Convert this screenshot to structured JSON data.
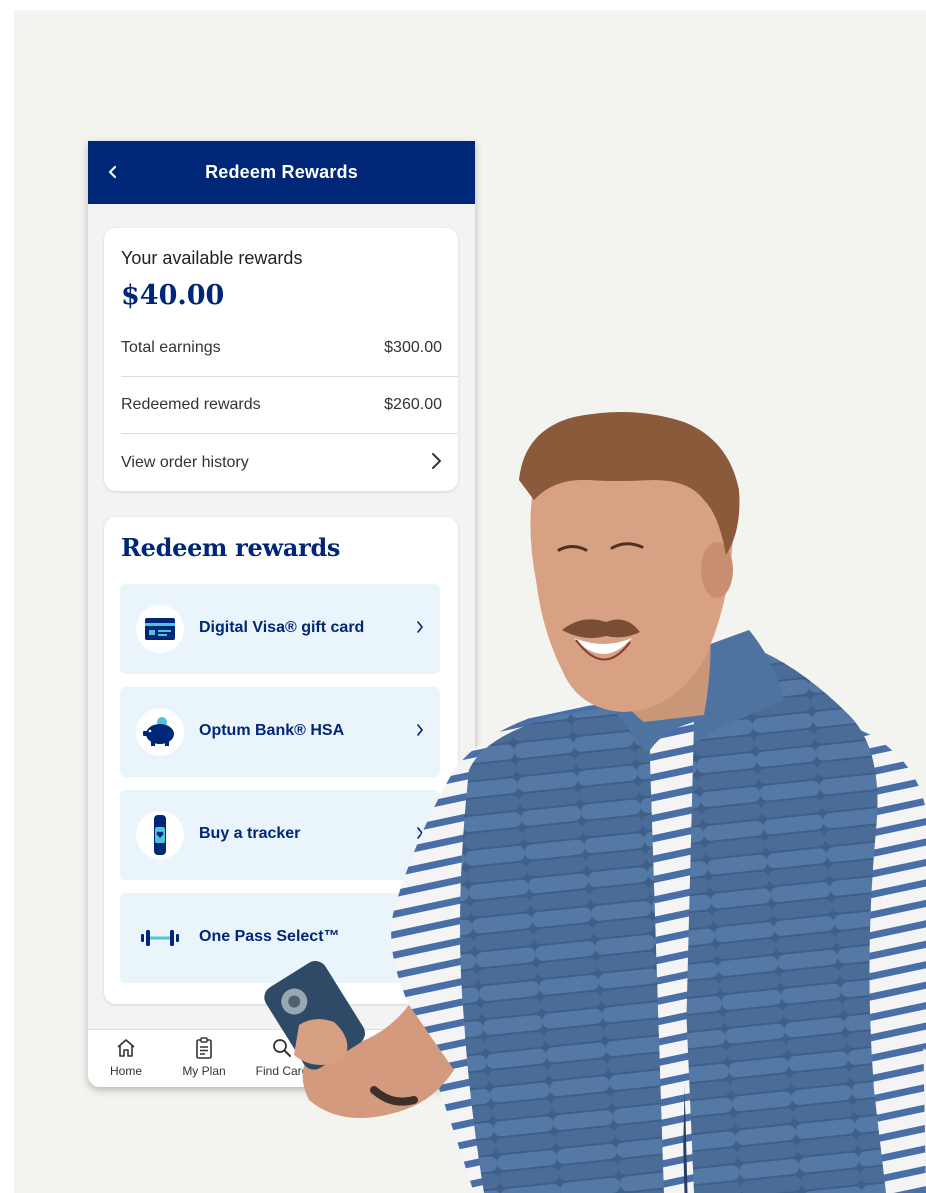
{
  "appbar": {
    "title": "Redeem Rewards"
  },
  "summary": {
    "available_label": "Your available rewards",
    "available_amount": "$40.00",
    "rows": [
      {
        "label": "Total earnings",
        "value": "$300.00"
      },
      {
        "label": "Redeemed rewards",
        "value": "$260.00"
      }
    ],
    "history_label": "View order history"
  },
  "redeem": {
    "title": "Redeem rewards",
    "options": [
      {
        "label": "Digital Visa® gift card",
        "icon": "credit-card-icon"
      },
      {
        "label": "Optum Bank® HSA",
        "icon": "piggy-bank-icon"
      },
      {
        "label": "Buy a tracker",
        "icon": "fitness-tracker-icon"
      },
      {
        "label": "One Pass Select™",
        "icon": "dumbbell-icon"
      }
    ]
  },
  "tabbar": {
    "tabs": [
      {
        "label": "Home",
        "icon": "home-icon"
      },
      {
        "label": "My Plan",
        "icon": "clipboard-icon"
      },
      {
        "label": "Find Care",
        "icon": "search-icon"
      }
    ]
  },
  "colors": {
    "brand_navy": "#002677",
    "tile_bg": "#eaf4fb",
    "accent_teal": "#4fc3d9",
    "background": "#f3f3ef"
  }
}
